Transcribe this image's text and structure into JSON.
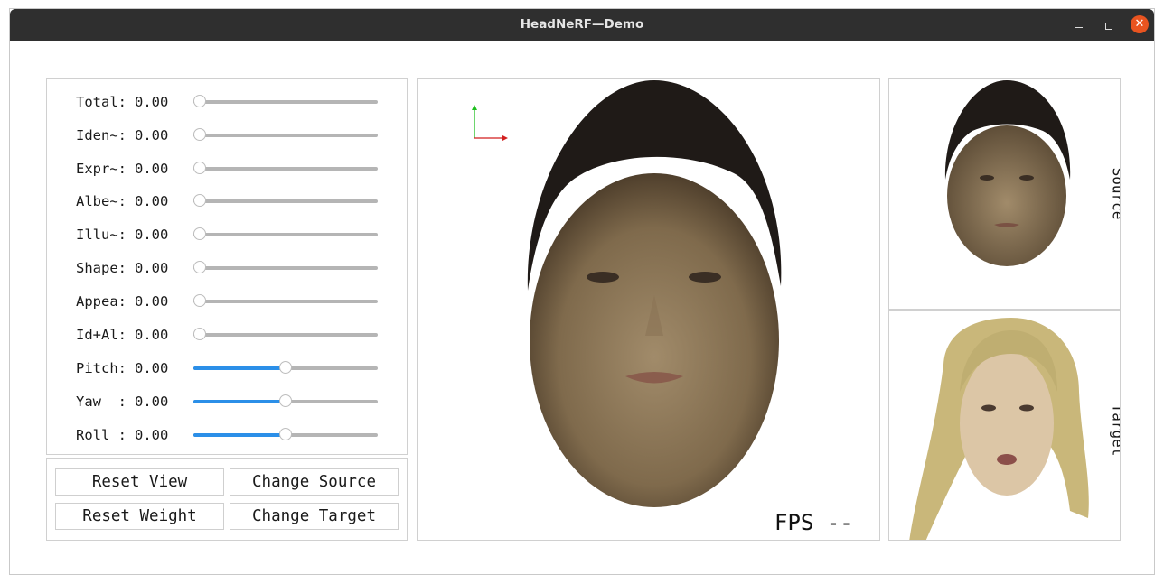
{
  "window": {
    "title": "HeadNeRF—Demo",
    "controls": {
      "minimize": "minimize-icon",
      "maximize": "maximize-icon",
      "close": "close-icon"
    },
    "accent_close": "#e95420"
  },
  "sliders": [
    {
      "label": "Total:",
      "value": "0.00",
      "level": 0.0,
      "filled": false
    },
    {
      "label": "Iden~:",
      "value": "0.00",
      "level": 0.0,
      "filled": false
    },
    {
      "label": "Expr~:",
      "value": "0.00",
      "level": 0.0,
      "filled": false
    },
    {
      "label": "Albe~:",
      "value": "0.00",
      "level": 0.0,
      "filled": false
    },
    {
      "label": "Illu~:",
      "value": "0.00",
      "level": 0.0,
      "filled": false
    },
    {
      "label": "Shape:",
      "value": "0.00",
      "level": 0.0,
      "filled": false
    },
    {
      "label": "Appea:",
      "value": "0.00",
      "level": 0.0,
      "filled": false
    },
    {
      "label": "Id+Al:",
      "value": "0.00",
      "level": 0.0,
      "filled": false
    },
    {
      "label": "Pitch:",
      "value": "0.00",
      "level": 0.5,
      "filled": true
    },
    {
      "label": "Yaw  :",
      "value": "0.00",
      "level": 0.5,
      "filled": true
    },
    {
      "label": "Roll :",
      "value": "0.00",
      "level": 0.5,
      "filled": true
    }
  ],
  "buttons": {
    "reset_view": "Reset View",
    "change_source": "Change Source",
    "reset_weight": "Reset Weight",
    "change_target": "Change Target"
  },
  "render_view": {
    "fps": "FPS --",
    "axes": {
      "y_color": "#1fbf1f",
      "x_color": "#d21f1f"
    }
  },
  "source_view": {
    "label": "Source"
  },
  "target_view": {
    "label": "Target"
  },
  "colors": {
    "slider_fill": "#2b8fe8",
    "slider_track": "#b5b5b5"
  }
}
